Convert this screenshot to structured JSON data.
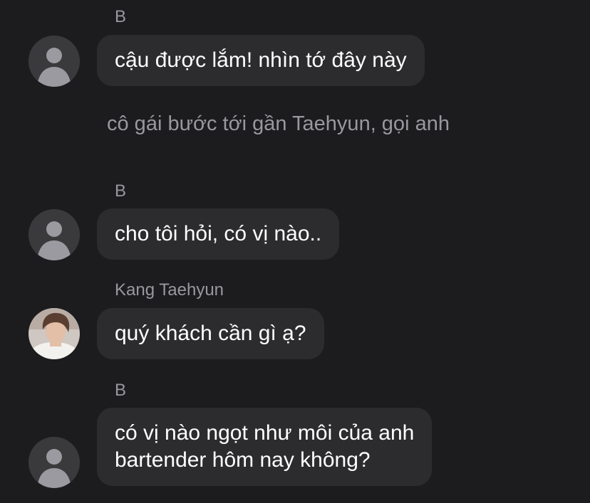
{
  "colors": {
    "background": "#1c1c1e",
    "bubble": "#2c2c2e",
    "sender_text": "#98989e",
    "message_text": "#ffffff",
    "avatar_placeholder": "#3a3a3c"
  },
  "messages": [
    {
      "sender": "B",
      "avatar": "default-person-icon",
      "lines": [
        "cậu được lắm! nhìn tớ đây này"
      ]
    },
    {
      "narration": "cô gái bước tới gần Taehyun, gọi anh"
    },
    {
      "sender": "B",
      "avatar": "default-person-icon",
      "lines": [
        "cho tôi hỏi, có vị nào.."
      ]
    },
    {
      "sender": "Kang Taehyun",
      "avatar": "profile-photo",
      "lines": [
        "quý khách cần gì ạ?"
      ]
    },
    {
      "sender": "B",
      "avatar": "default-person-icon",
      "lines": [
        "có vị nào ngọt như môi của anh",
        "bartender hôm nay không?"
      ]
    }
  ]
}
